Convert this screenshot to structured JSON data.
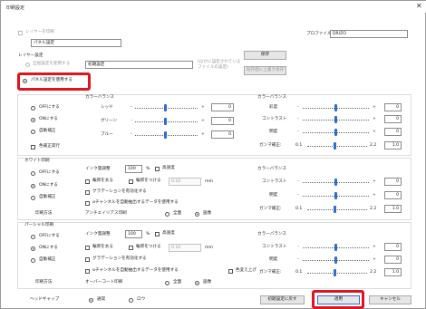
{
  "window": {
    "title": "印刷設定",
    "close": "✕"
  },
  "top": {
    "layer_label": "レイヤーを印刷",
    "panel_field": "パネル設定",
    "profile_label": "プロファイル",
    "profile_value": "DRIZO",
    "layer_group": "レイヤー設定",
    "radio1": "全般設定を使用する",
    "template_field": "初期設定",
    "note1": "(ほかに設定されている",
    "note2": "ファイルの設定)",
    "save_btn": "保存",
    "reset_btn": "既存値に上書き保存",
    "use_panel_radio": "パネル設定を使用する"
  },
  "color": {
    "balance": "カラーバランス",
    "balance2": "カラーバランス",
    "opt1": "OFFにする",
    "opt2": "ONにする",
    "opt3": "自動補正",
    "red": "レッド",
    "green": "グリーン",
    "blue": "ブルー",
    "plus": "+",
    "minus": "-",
    "v0": "0",
    "brightness": "彩度",
    "contrast": "コントラスト",
    "luminance": "明度",
    "gamma": "ガンマ補正",
    "gmin": "0.1",
    "gmax": "2.2",
    "g1": "1.0",
    "gamma_label": "ガンマ補正:",
    "vprint": "色補正実行"
  },
  "white": {
    "title": "ホワイト印刷",
    "ink_label": "インク量調整",
    "ink_value": "100",
    "pct": "%",
    "high_speed": "高速度",
    "edge": "輪郭を太る",
    "edge2": "輪郭をつける",
    "edge_val": "0.10",
    "mm": "mm",
    "gradient": "グラデーションを有効化する",
    "alpha": "αチャンネルを自動抽出するデータを使用する",
    "opt_label": "印刷方法",
    "antialias": "アンチエイリアス印刷",
    "all": "全面",
    "image": "画像"
  },
  "partial": {
    "title": "パーシャル印刷",
    "ink_value": "100",
    "edge_val": "0.10",
    "cancel_alpha": "色変え上げ",
    "opt_label": "印刷方法",
    "antialias": "オーバーコート印刷"
  },
  "footer": {
    "head_map": "ヘッドギャップ",
    "normal": "通常",
    "half": "ロウ",
    "restore": "初期設定に戻す",
    "apply": "適用",
    "cancel": "キャンセル"
  }
}
